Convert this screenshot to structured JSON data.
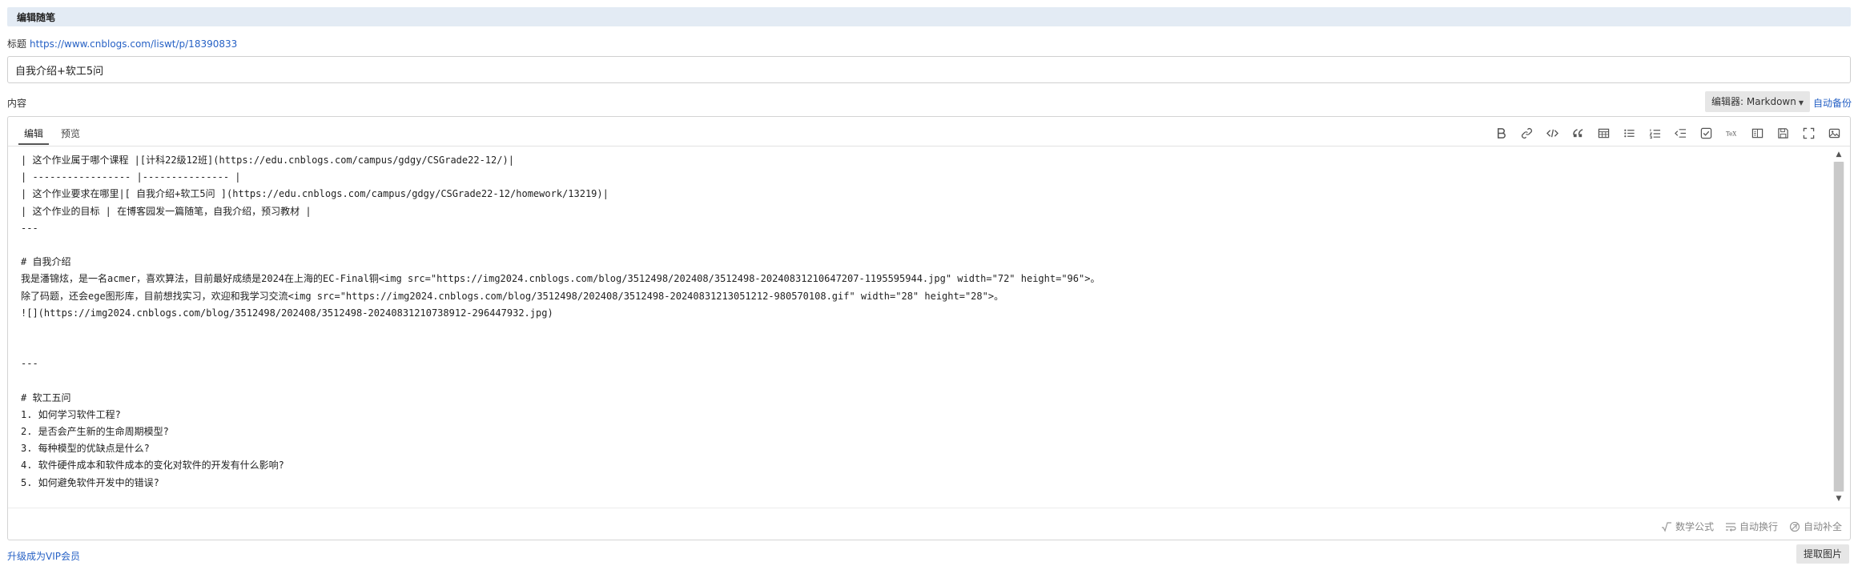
{
  "section_header": "编辑随笔",
  "title": {
    "label": "标题",
    "link": "https://www.cnblogs.com/liswt/p/18390833",
    "value": "自我介绍+软工5问"
  },
  "content_label": "内容",
  "editor_select": "编辑器: Markdown",
  "autosave": "自动备份",
  "tabs": [
    "编辑",
    "预览"
  ],
  "toolbar_icons": [
    "bold-icon",
    "link-icon",
    "code-icon",
    "quote-icon",
    "table-icon",
    "bullet-list-icon",
    "ordered-list-icon",
    "outdent-icon",
    "checkbox-icon",
    "tex-icon",
    "split-view-icon",
    "save-icon",
    "fullscreen-icon",
    "image-icon"
  ],
  "content_lines": [
    "| 这个作业属于哪个课程 |[计科22级12班](https://edu.cnblogs.com/campus/gdgy/CSGrade22-12/)|",
    "| ----------------- |--------------- |",
    "| 这个作业要求在哪里|[ 自我介绍+软工5问 ](https://edu.cnblogs.com/campus/gdgy/CSGrade22-12/homework/13219)|",
    "| 这个作业的目标 | 在博客园发一篇随笔，自我介绍，预习教材 |",
    "---",
    "",
    "# 自我介绍",
    "我是潘锦炫，是一名acmer，喜欢算法，目前最好成绩是2024在上海的EC-Final铜<img src=\"https://img2024.cnblogs.com/blog/3512498/202408/3512498-20240831210647207-1195595944.jpg\" width=\"72\" height=\"96\">。",
    "除了码题，还会ege图形库，目前想找实习，欢迎和我学习交流<img src=\"https://img2024.cnblogs.com/blog/3512498/202408/3512498-20240831213051212-980570108.gif\" width=\"28\" height=\"28\">。",
    "![](https://img2024.cnblogs.com/blog/3512498/202408/3512498-20240831210738912-296447932.jpg)",
    "",
    "",
    "---",
    "",
    "# 软工五问",
    "1. 如何学习软件工程?",
    "2. 是否会产生新的生命周期模型?",
    "3. 每种模型的优缺点是什么?",
    "4. 软件硬件成本和软件成本的变化对软件的开发有什么影响?",
    "5. 如何避免软件开发中的错误?"
  ],
  "footer_options": [
    {
      "icon": "sqrt-icon",
      "label": "数学公式"
    },
    {
      "icon": "wrap-icon",
      "label": "自动换行"
    },
    {
      "icon": "autocomplete-icon",
      "label": "自动补全"
    }
  ],
  "vip_link": "升级成为VIP会员",
  "extract_button": "提取图片"
}
